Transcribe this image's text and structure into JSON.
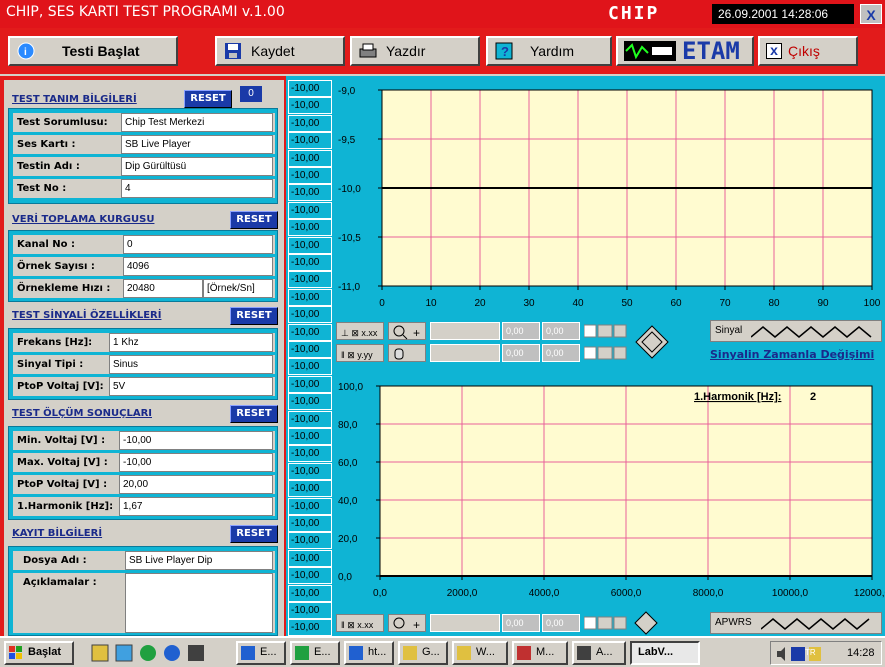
{
  "window": {
    "title": "CHIP, SES KARTI TEST PROGRAMI v.1.00",
    "logo": "CHIP",
    "datetime": "26.09.2001 14:28:06",
    "close": "X"
  },
  "toolbar": {
    "start": "Testi Başlat",
    "save": "Kaydet",
    "print": "Yazdır",
    "help": "Yardım",
    "brand": "ETAM",
    "exit": "Çıkış",
    "exit_x": "x"
  },
  "sections": {
    "test_def": {
      "title": "TEST TANIM BİLGİLERİ",
      "reset": "RESET",
      "counter": "0",
      "fields": [
        {
          "label": "Test Sorumlusu:",
          "value": "Chip Test Merkezi"
        },
        {
          "label": "Ses Kartı :",
          "value": "SB Live Player"
        },
        {
          "label": "Testin Adı :",
          "value": "Dip Gürültüsü"
        },
        {
          "label": "Test No :",
          "value": "4"
        }
      ]
    },
    "acq": {
      "title": "VERİ TOPLAMA KURGUSU",
      "reset": "RESET",
      "fields": [
        {
          "label": "Kanal No :",
          "value": "0"
        },
        {
          "label": "Örnek Sayısı :",
          "value": "4096"
        },
        {
          "label": "Örnekleme Hızı :",
          "value": "20480",
          "unit": "[Örnek/Sn]"
        }
      ]
    },
    "signal": {
      "title": "TEST SİNYALİ ÖZELLİKLERİ",
      "reset": "RESET",
      "fields": [
        {
          "label": "Frekans [Hz]:",
          "value": "1 Khz"
        },
        {
          "label": "Sinyal Tipi :",
          "value": "Sinus"
        },
        {
          "label": "PtoP Voltaj [V]:",
          "value": "5V"
        }
      ]
    },
    "results": {
      "title": "TEST ÖLÇÜM SONUÇLARI",
      "reset": "RESET",
      "fields": [
        {
          "label": "Min. Voltaj [V] :",
          "value": "-10,00"
        },
        {
          "label": "Max. Voltaj [V] :",
          "value": "-10,00"
        },
        {
          "label": "PtoP Voltaj [V] :",
          "value": "20,00"
        },
        {
          "label": "1.Harmonik [Hz]:",
          "value": "1,67"
        }
      ]
    },
    "record": {
      "title": "KAYIT BİLGİLERİ",
      "reset": "RESET",
      "fields": [
        {
          "label": "Dosya Adı :",
          "value": "SB Live Player Dip"
        },
        {
          "label": "Açıklamalar :",
          "value": ""
        }
      ]
    }
  },
  "numcol": [
    "-10,00",
    "-10,00",
    "-10,00",
    "-10,00",
    "-10,00",
    "-10,00",
    "-10,00",
    "-10,00",
    "-10,00",
    "-10,00",
    "-10,00",
    "-10,00",
    "-10,00",
    "-10,00",
    "-10,00",
    "-10,00",
    "-10,00",
    "-10,00",
    "-10,00",
    "-10,00",
    "-10,00",
    "-10,00",
    "-10,00",
    "-10,00",
    "-10,00",
    "-10,00",
    "-10,00",
    "-10,00",
    "-10,00",
    "-10,00",
    "-10,00",
    "-10,00"
  ],
  "plot_controls": {
    "readouts": [
      "0,00",
      "0,00",
      "0,00",
      "0,00"
    ],
    "legend1": "Sinyal",
    "caption1": "Sinyalin Zamanla Değişimi",
    "readouts2": [
      "0,00",
      "0,00"
    ],
    "legend2": "APWRS"
  },
  "chart_data": [
    {
      "type": "line",
      "title": "",
      "xlabel": "",
      "ylabel": "",
      "xlim": [
        0,
        100
      ],
      "ylim": [
        -11.0,
        -9.0
      ],
      "xticks": [
        "0",
        "10",
        "20",
        "30",
        "40",
        "50",
        "60",
        "70",
        "80",
        "90",
        "100"
      ],
      "yticks": [
        "-9,0",
        "-9,5",
        "-10,0",
        "-10,5",
        "-11,0"
      ],
      "series": [
        {
          "name": "Sinyal",
          "x": [
            0,
            100
          ],
          "y": [
            -10.0,
            -10.0
          ]
        }
      ],
      "grid": true
    },
    {
      "type": "line",
      "title": "",
      "annotation_label": "1.Harmonik [Hz]:",
      "annotation_value": "2",
      "xlim": [
        0,
        12000
      ],
      "ylim": [
        0,
        100
      ],
      "xticks": [
        "0,0",
        "2000,0",
        "4000,0",
        "6000,0",
        "8000,0",
        "10000,0",
        "12000,0"
      ],
      "yticks": [
        "100,0",
        "80,0",
        "60,0",
        "40,0",
        "20,0",
        "0,0"
      ],
      "series": [
        {
          "name": "APWRS",
          "x": [
            0,
            12000
          ],
          "y": [
            0,
            0
          ]
        }
      ],
      "grid": true
    }
  ],
  "taskbar": {
    "start": "Başlat",
    "items": [
      "E...",
      "E...",
      "ht...",
      "G...",
      "W...",
      "M...",
      "A...",
      "LabV..."
    ],
    "clock": "14:28",
    "lang": "TR"
  }
}
